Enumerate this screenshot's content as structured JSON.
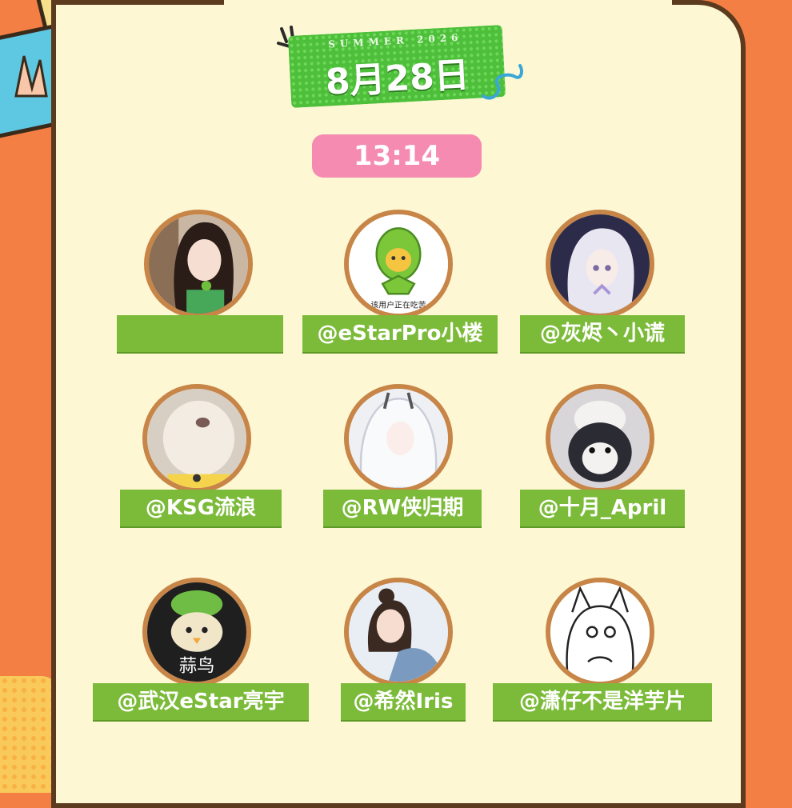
{
  "header": {
    "season_label": "SUMMER 2026",
    "date": "8月28日",
    "time": "13:14"
  },
  "profiles": [
    {
      "name": "",
      "avatar": "girl-photo"
    },
    {
      "name": "@eStarPro小楼",
      "avatar": "durian-mascot",
      "avatar_caption": "该用户正在吃苦"
    },
    {
      "name": "@灰烬丶小谎",
      "avatar": "anime-white-hair"
    },
    {
      "name": "@KSG流浪",
      "avatar": "cat-photo"
    },
    {
      "name": "@RW侠归期",
      "avatar": "anime-silver-hair"
    },
    {
      "name": "@十月_April",
      "avatar": "penguin-photo"
    },
    {
      "name": "@武汉eStar亮宇",
      "avatar": "garlic-bird",
      "avatar_caption": "蒜鸟"
    },
    {
      "name": "@希然Iris",
      "avatar": "girl-bun-photo"
    },
    {
      "name": "@潇仔不是洋芋片",
      "avatar": "sketch-cat-girl"
    }
  ],
  "colors": {
    "background": "#f47f45",
    "card": "#fdf7d3",
    "banner_green": "#4dbf3a",
    "tag_green": "#7cbb3a",
    "time_pink": "#f58bb0",
    "avatar_ring": "#c78547"
  }
}
